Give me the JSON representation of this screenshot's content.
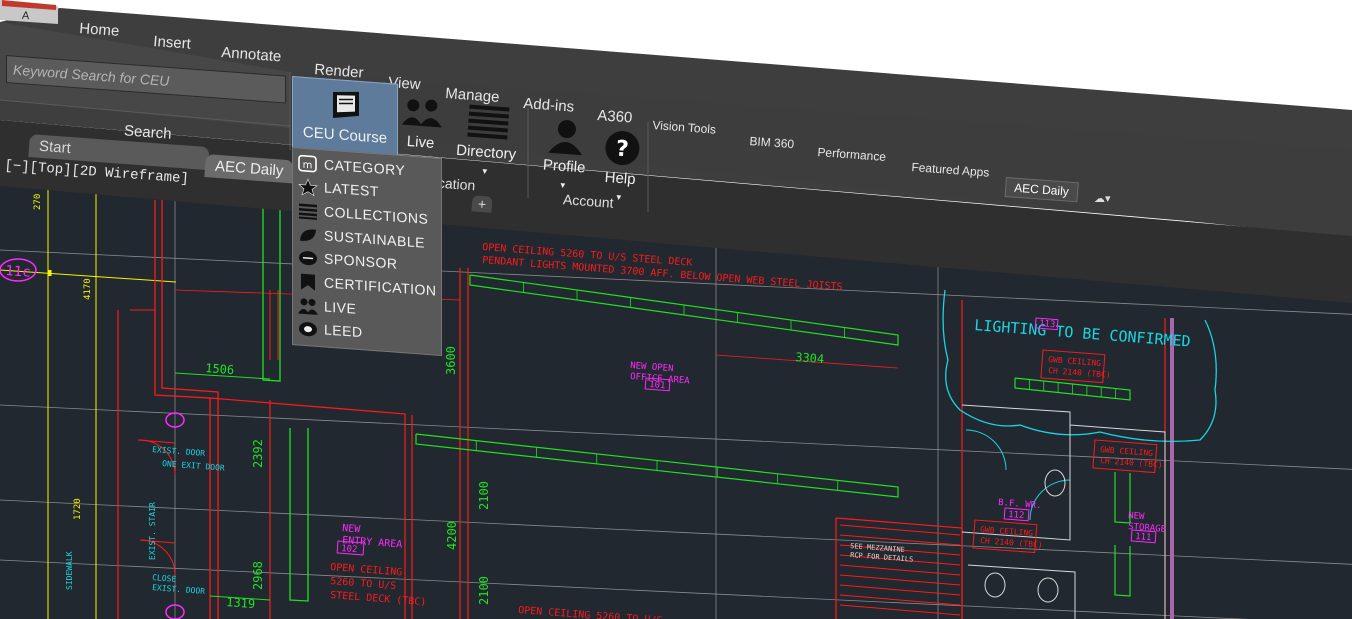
{
  "app": {
    "menu_letter": "A"
  },
  "ribbon": {
    "tabs": [
      "Home",
      "Insert",
      "Annotate",
      "Render",
      "View",
      "Manage",
      "Add-ins",
      "A360",
      "Vision Tools",
      "BIM 360",
      "Performance",
      "Featured Apps",
      "AEC Daily"
    ],
    "active_tab": "AEC Daily",
    "search": {
      "placeholder": "Keyword Search for CEU",
      "panel_label": "Search"
    },
    "buttons": {
      "ceu_course": "CEU Course",
      "live": "Live",
      "directory": "Directory",
      "profile": "Profile",
      "help": "Help"
    },
    "panel_labels": {
      "education_partial": "cation",
      "account": "Account"
    }
  },
  "file_tabs": {
    "start": "Start",
    "aec_daily": "AEC Daily",
    "add": "+"
  },
  "viewport": {
    "view_label": "[−][Top][2D Wireframe]"
  },
  "dropdown": {
    "items": [
      {
        "label": "CATEGORY",
        "icon": "category-icon"
      },
      {
        "label": "LATEST",
        "icon": "star-icon"
      },
      {
        "label": "COLLECTIONS",
        "icon": "list-icon"
      },
      {
        "label": "SUSTAINABLE",
        "icon": "leaf-icon"
      },
      {
        "label": "SPONSOR",
        "icon": "sponsor-icon"
      },
      {
        "label": "CERTIFICATION",
        "icon": "bookmark-icon"
      },
      {
        "label": "LIVE",
        "icon": "people-icon"
      },
      {
        "label": "LEED",
        "icon": "leed-icon"
      }
    ]
  },
  "drawing": {
    "room_labels": {
      "open_office": "NEW OPEN\nOFFICE AREA",
      "open_office_num": "101",
      "entry": "NEW\nENTRY AREA",
      "entry_num": "102",
      "bf_wr": "B.F. WR.",
      "bf_wr_num": "112",
      "storage": "NEW\nSTORAGE",
      "storage_num": "111",
      "room_113": "113"
    },
    "notes": {
      "ceiling_top": "OPEN CEILING 5260 TO U/S STEEL DECK",
      "pendant": "PENDANT LIGHTS MOUNTED 3700 AFF. BELOW OPEN WEB STEEL JOISTS",
      "lighting": "LIGHTING TO BE CONFIRMED",
      "open_ceiling": "OPEN CEILING",
      "ceil_5260": "5260 TO U/S",
      "steel_deck": "STEEL DECK (TBC)",
      "gwb1": "GWB CEILING",
      "ch2140": "CH 2140 (TBC)",
      "gwb2": "GWB CEILING",
      "ch2140b": "CH 2140 (TBC)",
      "gwb3": "GWB CEILING",
      "ch2140c": "CH 2140 (TBC)",
      "see_mezz": "SEE MEZZANINE",
      "rcp": "RCP FOR DETAILS",
      "exist_door": "EXIST. DOOR",
      "exit_door": "ONE EXIT DOOR",
      "close_door": "CLOSE",
      "exist_door2": "EXIST. DOOR",
      "exist_stair": "EXIST. STAIR",
      "sidewalk": "SIDEWALK",
      "open_ceiling_bottom": "OPEN CEILING 5260 TO U/S"
    },
    "dimensions": {
      "d1506": "1506",
      "d3304": "3304",
      "d3600": "3600",
      "d2392": "2392",
      "d2100": "2100",
      "d4200": "4200",
      "d2100b": "2100",
      "d2968": "2968",
      "d1319": "1319",
      "d1720": "1720",
      "d4170": "4170",
      "d270": "270"
    },
    "grid_bubble": "11c"
  },
  "colors": {
    "ribbon_bg": "#3c3c3c",
    "panel_bg": "#474747",
    "cad_bg": "#212830",
    "red": "#ff1a1a",
    "green": "#22e022",
    "yellow": "#f5f500",
    "magenta": "#ff2aff",
    "cyan": "#19d6e0",
    "white_line": "#d8d8d8",
    "active_blue": "#5e7b9c"
  }
}
